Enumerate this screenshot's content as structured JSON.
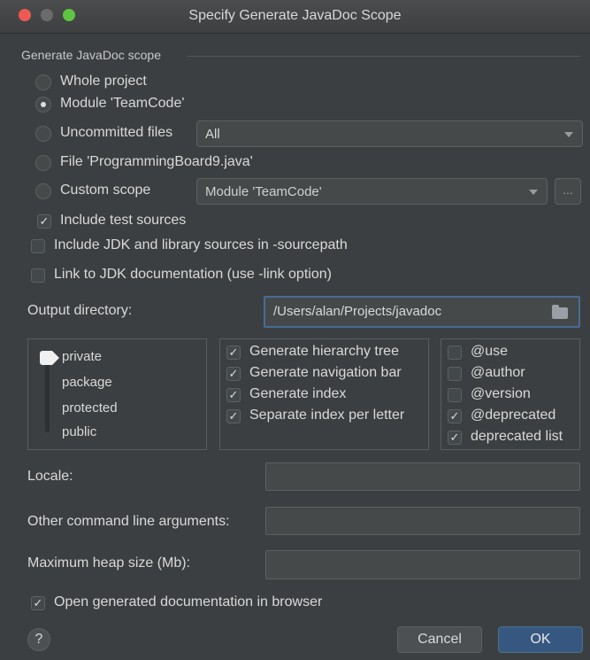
{
  "window": {
    "title": "Specify Generate JavaDoc Scope"
  },
  "scope": {
    "section_title": "Generate JavaDoc scope",
    "options": [
      {
        "label": "Whole project",
        "selected": false
      },
      {
        "label": "Module 'TeamCode'",
        "selected": true
      },
      {
        "label": "Uncommitted files",
        "selected": false
      },
      {
        "label": "File 'ProgrammingBoard9.java'",
        "selected": false
      },
      {
        "label": "Custom scope",
        "selected": false
      }
    ],
    "uncommitted_combo": "All",
    "custom_scope_combo": "Module 'TeamCode'",
    "browse_label": "...",
    "include_test_sources": {
      "label": "Include test sources",
      "checked": true
    },
    "include_jdk": {
      "label": "Include JDK and library sources in -sourcepath",
      "checked": false
    },
    "link_jdk": {
      "label": "Link to JDK documentation (use -link option)",
      "checked": false
    }
  },
  "output": {
    "label": "Output directory:",
    "value": "/Users/alan/Projects/javadoc"
  },
  "visibility": {
    "levels": [
      "private",
      "package",
      "protected",
      "public"
    ],
    "selected": "private"
  },
  "generate_options": [
    {
      "label": "Generate hierarchy tree",
      "checked": true
    },
    {
      "label": "Generate navigation bar",
      "checked": true
    },
    {
      "label": "Generate index",
      "checked": true
    },
    {
      "label": "Separate index per letter",
      "checked": true
    }
  ],
  "tags": [
    {
      "label": "@use",
      "checked": false
    },
    {
      "label": "@author",
      "checked": false
    },
    {
      "label": "@version",
      "checked": false
    },
    {
      "label": "@deprecated",
      "checked": true
    },
    {
      "label": "deprecated list",
      "checked": true
    }
  ],
  "fields": {
    "locale_label": "Locale:",
    "locale_value": "",
    "args_label": "Other command line arguments:",
    "args_value": "",
    "heap_label": "Maximum heap size (Mb):",
    "heap_value": ""
  },
  "open_in_browser": {
    "label": "Open generated documentation in browser",
    "checked": true
  },
  "buttons": {
    "help": "?",
    "cancel": "Cancel",
    "ok": "OK"
  },
  "colors": {
    "background": "#3c3f41",
    "accent": "#365880",
    "focus": "#466d94"
  }
}
